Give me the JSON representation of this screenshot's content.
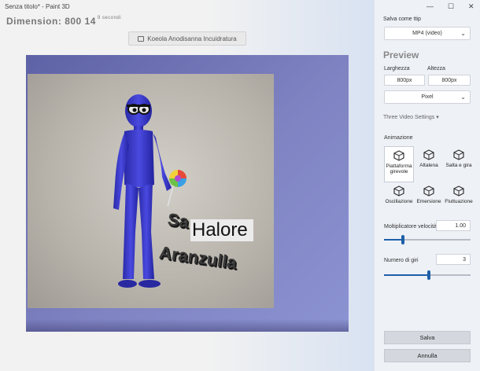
{
  "window": {
    "title": "Senza titolo* - Paint 3D",
    "controls": [
      "—",
      "☐",
      "✕"
    ]
  },
  "canvas": {
    "dimension_label": "Dimension:",
    "dimension_value": "800 14",
    "dimension_sub": "9 secondi",
    "reset_button": "Koeola Anodisanna Incuidratura",
    "halore_text": "Halore",
    "text_3d_1": "Sa",
    "text_3d_2": "Aranzulla"
  },
  "panel": {
    "save_as_label": "Salva come ttip",
    "format_value": "MP4 (video)",
    "preview_title": "Preview",
    "width_label": "Larghezza",
    "height_label": "Altezza",
    "width_value": "800px",
    "height_value": "800px",
    "unit_value": "Pixel",
    "three_video_settings": "Three Video Settings",
    "animation_label": "Animazione",
    "animations": [
      {
        "label": "Piattaforma girevole",
        "icon": "turntable-icon",
        "selected": true
      },
      {
        "label": "Altalena",
        "icon": "swing-icon",
        "selected": false
      },
      {
        "label": "Salta e gira",
        "icon": "jump-spin-icon",
        "selected": false
      },
      {
        "label": "Oscillazione",
        "icon": "oscillate-icon",
        "selected": false
      },
      {
        "label": "Emersione",
        "icon": "emerge-icon",
        "selected": false
      },
      {
        "label": "Fluttuazione",
        "icon": "float-icon",
        "selected": false
      }
    ],
    "speed_label": "Moltiplicatore velocità",
    "speed_value": "1.00",
    "speed_fraction": 0.22,
    "turns_label": "Numero di giri",
    "turns_value": "3",
    "turns_fraction": 0.52,
    "save_button": "Salva",
    "cancel_button": "Annulla"
  },
  "colors": {
    "accent": "#1f5fa8",
    "figure": "#3535c8",
    "scene_bg": "#7f83c2"
  }
}
